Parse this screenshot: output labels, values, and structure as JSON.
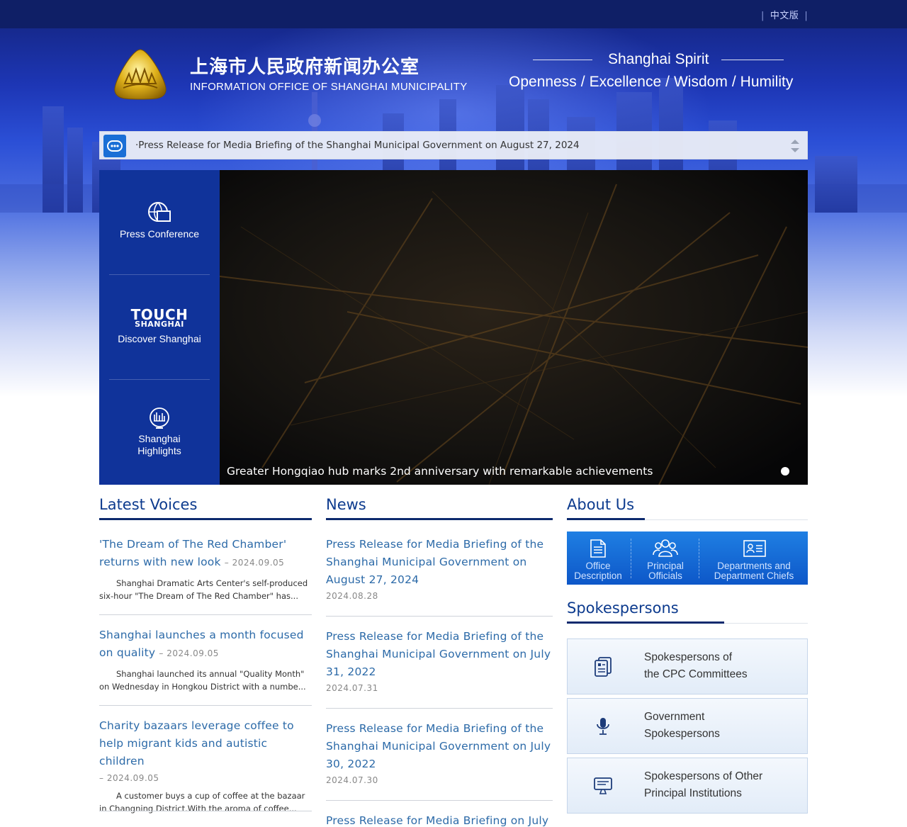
{
  "header": {
    "lang_link": "中文版",
    "title_cn": "上海市人民政府新闻办公室",
    "title_en": "INFORMATION OFFICE OF SHANGHAI MUNICIPALITY",
    "spirit_title": "Shanghai Spirit",
    "spirit_words": [
      "Openness",
      "Excellence",
      "Wisdom",
      "Humility"
    ],
    "spirit_sep": "/"
  },
  "ticker": {
    "text": "·Press Release for Media Briefing of the Shanghai Municipal Government on August 27, 2024"
  },
  "side_nav": {
    "items": [
      {
        "label": "Press Conference"
      },
      {
        "logo_main": "TOUCH",
        "logo_sub": "SHANGHAI",
        "label": "Discover Shanghai"
      },
      {
        "label_line1": "Shanghai",
        "label_line2": "Highlights"
      }
    ]
  },
  "slide": {
    "caption": "Greater Hongqiao hub marks 2nd anniversary with remarkable achievements"
  },
  "latest_voices": {
    "heading": "Latest Voices",
    "items": [
      {
        "title_line1": "'The Dream of The Red Chamber'",
        "title_line2": "returns with new look",
        "date": "– 2024.09.05",
        "desc_line1": "Shanghai Dramatic Arts Center's self-produced",
        "desc_line2": "six-hour \"The Dream of The Red Chamber\" has..."
      },
      {
        "title_line1": "Shanghai launches a month focused",
        "title_line2": "on quality",
        "date": "– 2024.09.05",
        "desc_line1": "Shanghai launched its annual \"Quality Month\"",
        "desc_line2": "on Wednesday in Hongkou District with a numbe..."
      },
      {
        "title_line1": "Charity bazaars leverage coffee to",
        "title_line2": "help migrant kids and autistic children",
        "date": "– 2024.09.05",
        "desc_line1": "A customer buys a cup of coffee at the bazaar",
        "desc_line2": "in Changning District.With the aroma of coffee..."
      }
    ]
  },
  "news": {
    "heading": "News",
    "items": [
      {
        "line1": "Press Release for Media Briefing of the",
        "line2": "Shanghai Municipal Government on",
        "line3": "August 27, 2024",
        "date": "2024.08.28"
      },
      {
        "line1": "Press Release for Media Briefing of the",
        "line2": "Shanghai Municipal Government on July",
        "line3": "31, 2022",
        "date": "2024.07.31"
      },
      {
        "line1": "Press Release for Media Briefing of the",
        "line2": "Shanghai Municipal Government on July",
        "line3": "30, 2022",
        "date": "2024.07.30"
      },
      {
        "line1": "Press Release for Media Briefing on July"
      }
    ]
  },
  "about": {
    "heading": "About Us",
    "cells": [
      {
        "line1": "Office",
        "line2": "Description"
      },
      {
        "line1": "Principal",
        "line2": "Officials"
      },
      {
        "line1": "Departments and",
        "line2": "Department Chiefs"
      }
    ]
  },
  "spokespersons": {
    "heading": "Spokespersons",
    "cards": [
      {
        "line1": "Spokespersons of",
        "line2": "the CPC Committees",
        "icon": "document-icon"
      },
      {
        "line1": "Government",
        "line2": "Spokespersons",
        "icon": "microphone-icon"
      },
      {
        "line1": "Spokespersons of Other",
        "line2": "Principal Institutions",
        "icon": "monitor-icon"
      }
    ]
  }
}
